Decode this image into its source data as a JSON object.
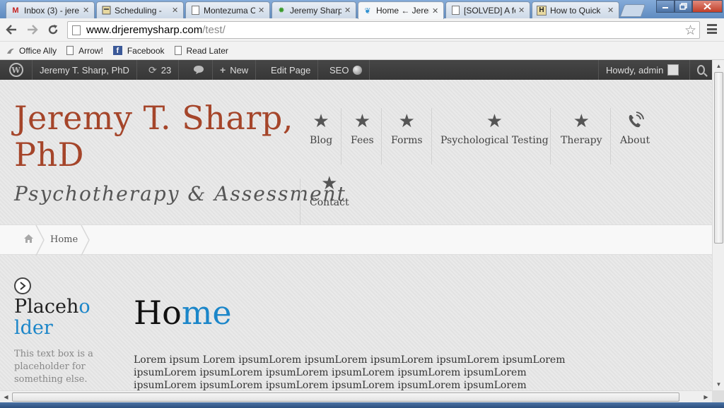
{
  "browser": {
    "tabs": [
      {
        "label": "Inbox (3) - jere",
        "icon": "gmail-icon",
        "active": false
      },
      {
        "label": "Scheduling - ",
        "icon": "scheduling-icon",
        "active": false
      },
      {
        "label": "Montezuma C",
        "icon": "page-icon",
        "active": false
      },
      {
        "label": "Jeremy Sharp",
        "icon": "leaf-icon",
        "active": false
      },
      {
        "label": "Home ← Jerer",
        "icon": "feather-icon",
        "active": true
      },
      {
        "label": "[SOLVED] A fe",
        "icon": "page-icon",
        "active": false
      },
      {
        "label": "How to Quick",
        "icon": "h-icon",
        "active": false
      }
    ],
    "close_glyph": "✕",
    "url_host": "www.drjeremysharp.com",
    "url_path": "/test/",
    "bookmarks": [
      {
        "label": "Office Ally",
        "icon": "officeally-icon"
      },
      {
        "label": "Arrow!",
        "icon": "page-icon"
      },
      {
        "label": "Facebook",
        "icon": "facebook-icon"
      },
      {
        "label": "Read Later",
        "icon": "page-icon"
      }
    ]
  },
  "adminbar": {
    "site_name": "Jeremy T. Sharp, PhD",
    "updates_count": "23",
    "new_label": "New",
    "edit_page_label": "Edit Page",
    "seo_label": "SEO",
    "howdy_label": "Howdy, admin"
  },
  "site": {
    "title": "Jeremy T. Sharp, PhD",
    "tagline": "Psychotherapy & Assessment",
    "nav": [
      {
        "label": "Blog",
        "icon": "star-icon"
      },
      {
        "label": "Fees",
        "icon": "star-icon"
      },
      {
        "label": "Forms",
        "icon": "star-icon"
      },
      {
        "label": "Psychological Testing",
        "icon": "star-icon"
      },
      {
        "label": "Therapy",
        "icon": "star-icon"
      },
      {
        "label": "About",
        "icon": "phone-icon"
      },
      {
        "label": "Contact",
        "icon": "star-icon"
      }
    ],
    "breadcrumb": {
      "current": "Home"
    }
  },
  "sidebar": {
    "title_dark": "Placeh",
    "title_blue_1": "o",
    "title_blue_2": "lder",
    "text": "This text box is a placeholder for something else."
  },
  "main": {
    "title_dark": "Ho",
    "title_blue": "me",
    "body": "Lorem ipsum Lorem ipsumLorem ipsumLorem ipsumLorem ipsumLorem ipsumLorem ipsumLorem ipsumLorem ipsumLorem ipsumLorem ipsumLorem ipsumLorem ipsumLorem ipsumLorem ipsumLorem ipsumLorem ipsumLorem ipsumLorem"
  },
  "colors": {
    "title_accent": "#a5452a",
    "link_blue": "#1b86c9"
  }
}
